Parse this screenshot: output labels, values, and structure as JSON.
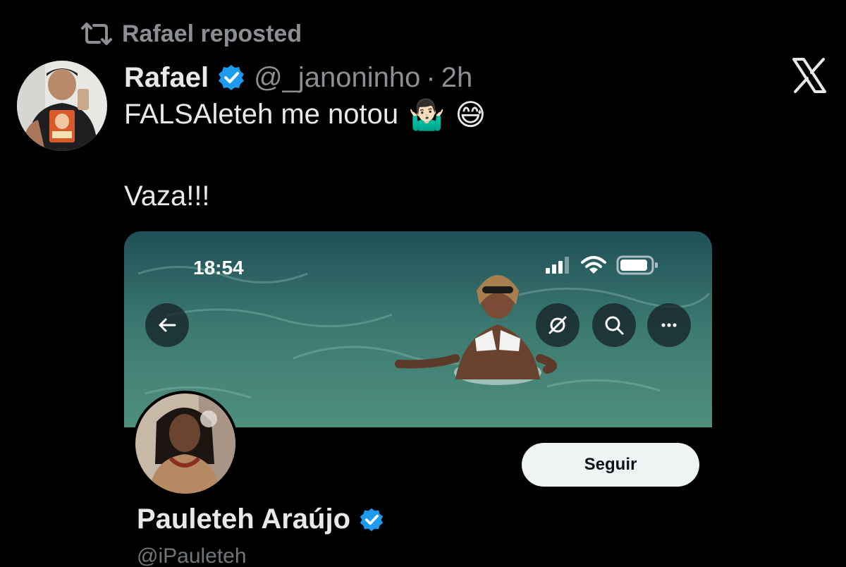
{
  "repost": {
    "icon": "repost-icon",
    "text": "Rafael reposted"
  },
  "post": {
    "author_name": "Rafael",
    "handle": "@_janoninho",
    "separator": "·",
    "time": "2h",
    "line1": "FALSAleteh me notou",
    "emoji_1": "🤷🏻‍♂️",
    "emoji_2": "😅",
    "line2": "Vaza!!!"
  },
  "embedded": {
    "status_time": "18:54",
    "follow_label": "Seguir",
    "profile_name": "Pauleteh Araújo",
    "profile_handle": "@iPauleteh"
  },
  "colors": {
    "background": "#000000",
    "text": "#e7e9ea",
    "secondary_text": "#8b8f94",
    "verified_blue": "#1d9bf0",
    "follow_button": "#eff3f4"
  }
}
